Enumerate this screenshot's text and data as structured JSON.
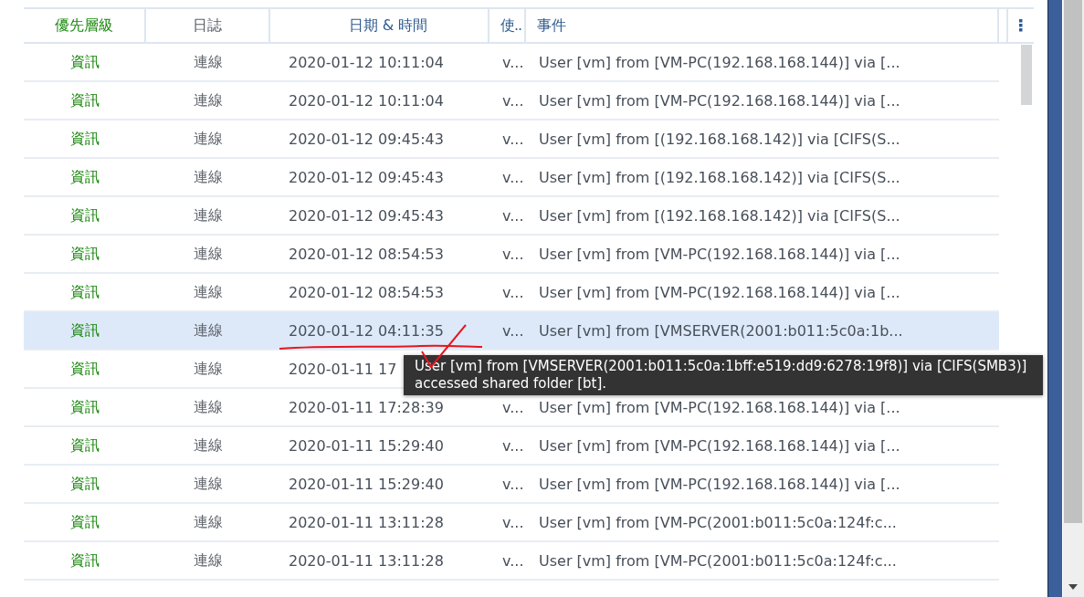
{
  "table": {
    "columns": [
      {
        "label": "優先層級"
      },
      {
        "label": "日誌"
      },
      {
        "label": "日期 & 時間"
      },
      {
        "label": "使.."
      },
      {
        "label": "事件"
      }
    ],
    "rows": [
      {
        "priority": "資訊",
        "log": "連線",
        "datetime": "2020-01-12 10:11:04",
        "user": "v...",
        "event": "User [vm] from [VM-PC(192.168.168.144)] via [...",
        "selected": false
      },
      {
        "priority": "資訊",
        "log": "連線",
        "datetime": "2020-01-12 10:11:04",
        "user": "v...",
        "event": "User [vm] from [VM-PC(192.168.168.144)] via [...",
        "selected": false
      },
      {
        "priority": "資訊",
        "log": "連線",
        "datetime": "2020-01-12 09:45:43",
        "user": "v...",
        "event": "User [vm] from [(192.168.168.142)] via [CIFS(S...",
        "selected": false
      },
      {
        "priority": "資訊",
        "log": "連線",
        "datetime": "2020-01-12 09:45:43",
        "user": "v...",
        "event": "User [vm] from [(192.168.168.142)] via [CIFS(S...",
        "selected": false
      },
      {
        "priority": "資訊",
        "log": "連線",
        "datetime": "2020-01-12 09:45:43",
        "user": "v...",
        "event": "User [vm] from [(192.168.168.142)] via [CIFS(S...",
        "selected": false
      },
      {
        "priority": "資訊",
        "log": "連線",
        "datetime": "2020-01-12 08:54:53",
        "user": "v...",
        "event": "User [vm] from [VM-PC(192.168.168.144)] via [...",
        "selected": false
      },
      {
        "priority": "資訊",
        "log": "連線",
        "datetime": "2020-01-12 08:54:53",
        "user": "v...",
        "event": "User [vm] from [VM-PC(192.168.168.144)] via [...",
        "selected": false
      },
      {
        "priority": "資訊",
        "log": "連線",
        "datetime": "2020-01-12 04:11:35",
        "user": "v...",
        "event": "User [vm] from [VMSERVER(2001:b011:5c0a:1b...",
        "selected": true
      },
      {
        "priority": "資訊",
        "log": "連線",
        "datetime": "2020-01-11 17",
        "selected": false
      },
      {
        "priority": "資訊",
        "log": "連線",
        "datetime": "2020-01-11 17:28:39",
        "user": "v...",
        "event": "User [vm] from [VM-PC(192.168.168.144)] via [...",
        "selected": false
      },
      {
        "priority": "資訊",
        "log": "連線",
        "datetime": "2020-01-11 15:29:40",
        "user": "v...",
        "event": "User [vm] from [VM-PC(192.168.168.144)] via [...",
        "selected": false
      },
      {
        "priority": "資訊",
        "log": "連線",
        "datetime": "2020-01-11 15:29:40",
        "user": "v...",
        "event": "User [vm] from [VM-PC(192.168.168.144)] via [...",
        "selected": false
      },
      {
        "priority": "資訊",
        "log": "連線",
        "datetime": "2020-01-11 13:11:28",
        "user": "v...",
        "event": "User [vm] from [VM-PC(2001:b011:5c0a:124f:c...",
        "selected": false
      },
      {
        "priority": "資訊",
        "log": "連線",
        "datetime": "2020-01-11 13:11:28",
        "user": "v...",
        "event": "User [vm] from [VM-PC(2001:b011:5c0a:124f:c...",
        "selected": false
      }
    ]
  },
  "tooltip": {
    "text": "User [vm] from [VMSERVER(2001:b011:5c0a:1bff:e519:dd9:6278:19f8)] via [CIFS(SMB3)] accessed shared folder [bt]."
  }
}
